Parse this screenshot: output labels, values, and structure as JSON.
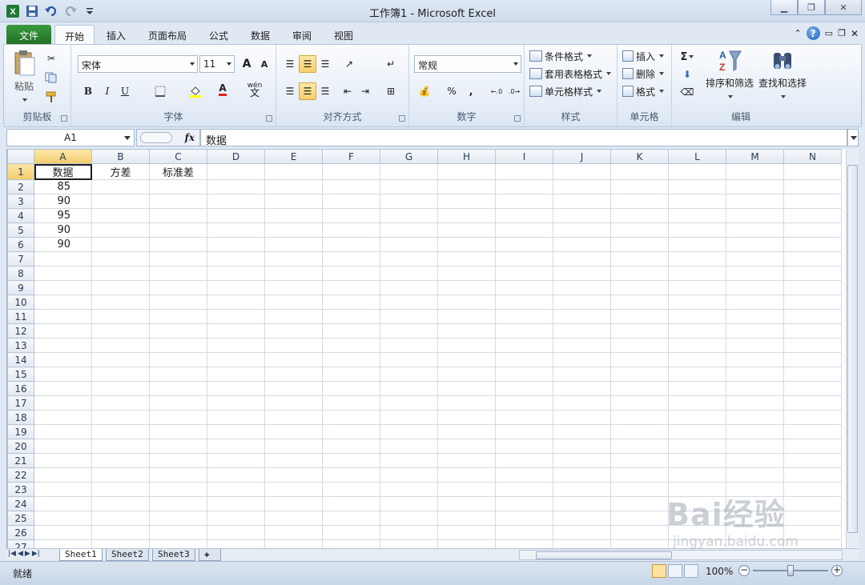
{
  "window": {
    "title": "工作簿1 - Microsoft Excel"
  },
  "tabs": [
    "文件",
    "开始",
    "插入",
    "页面布局",
    "公式",
    "数据",
    "审阅",
    "视图"
  ],
  "ribbon": {
    "clipboard": {
      "label": "剪贴板",
      "paste": "粘贴"
    },
    "font": {
      "label": "字体",
      "name": "宋体",
      "size": "11",
      "bold": "B",
      "italic": "I",
      "underline": "U",
      "grow": "A",
      "shrink": "A",
      "font_color": "A",
      "phonetic": "wén"
    },
    "alignment": {
      "label": "对齐方式"
    },
    "number": {
      "label": "数字",
      "format": "常规",
      "percent": "%",
      "comma": ","
    },
    "styles": {
      "label": "样式",
      "conditional": "条件格式",
      "table_format": "套用表格格式",
      "cell_styles": "单元格样式"
    },
    "cells": {
      "label": "单元格",
      "insert": "插入",
      "delete": "删除",
      "format": "格式"
    },
    "editing": {
      "label": "编辑",
      "sort_filter": "排序和筛选",
      "find_select": "查找和选择",
      "sigma": "Σ"
    }
  },
  "formula_bar": {
    "name_box": "A1",
    "fx": "fx",
    "content": "数据"
  },
  "grid": {
    "columns": [
      "A",
      "B",
      "C",
      "D",
      "E",
      "F",
      "G",
      "H",
      "I",
      "J",
      "K",
      "L",
      "M",
      "N"
    ],
    "rows": [
      [
        "数据",
        "方差",
        "标准差"
      ],
      [
        "85",
        "",
        ""
      ],
      [
        "90",
        "",
        ""
      ],
      [
        "95",
        "",
        ""
      ],
      [
        "90",
        "",
        ""
      ],
      [
        "90",
        "",
        ""
      ]
    ],
    "row_count": 27
  },
  "sheets": [
    "Sheet1",
    "Sheet2",
    "Sheet3"
  ],
  "status": {
    "text": "就绪",
    "zoom": "100%",
    "minus": "−",
    "plus": "+"
  },
  "watermark": {
    "brand": "Bai经验",
    "url": "jingyan.baidu.com"
  }
}
